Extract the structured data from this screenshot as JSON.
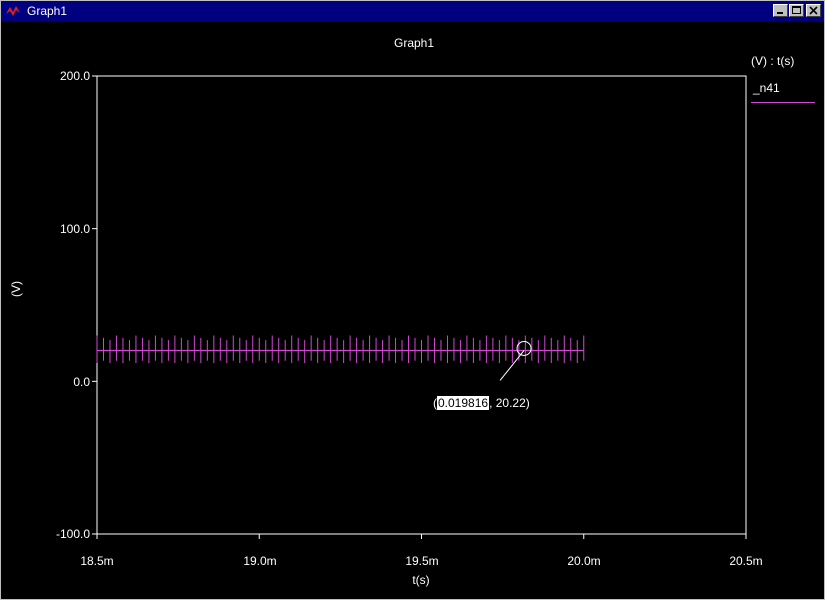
{
  "window": {
    "title": "Graph1",
    "app_icon": "app-logo-icon",
    "buttons": [
      "minimize-icon",
      "maximize-icon",
      "close-icon"
    ]
  },
  "colors": {
    "background": "#000000",
    "axes": "#ffffff",
    "series": "#d048d0",
    "titlebar": "#000080"
  },
  "chart_data": {
    "type": "line",
    "title": "Graph1",
    "xlabel": "t(s)",
    "ylabel": "(V)",
    "legend_header": "(V) : t(s)",
    "legend_placement": "right",
    "grid": false,
    "xlim": [
      18.5,
      20.5
    ],
    "ylim": [
      -100,
      200
    ],
    "x_unit": "ms",
    "x_tick_labels": [
      "18.5m",
      "19.0m",
      "19.5m",
      "20.0m",
      "20.5m"
    ],
    "y_tick_labels": [
      "200.0",
      "100.0",
      "0.0",
      "-100.0"
    ],
    "x_ticks": [
      18.5,
      19.0,
      19.5,
      20.0,
      20.5
    ],
    "y_ticks": [
      200,
      100,
      0,
      -100
    ],
    "series": [
      {
        "name": "_n41",
        "description_type": "ripple",
        "x_range": [
          18.5,
          20.0
        ],
        "mean": 20.22,
        "min": 12,
        "max": 30,
        "cycles": 75
      }
    ],
    "annotation": {
      "x_text": "0.019816",
      "y_text": "20.22",
      "x": 19.816,
      "y": 20.22
    }
  }
}
